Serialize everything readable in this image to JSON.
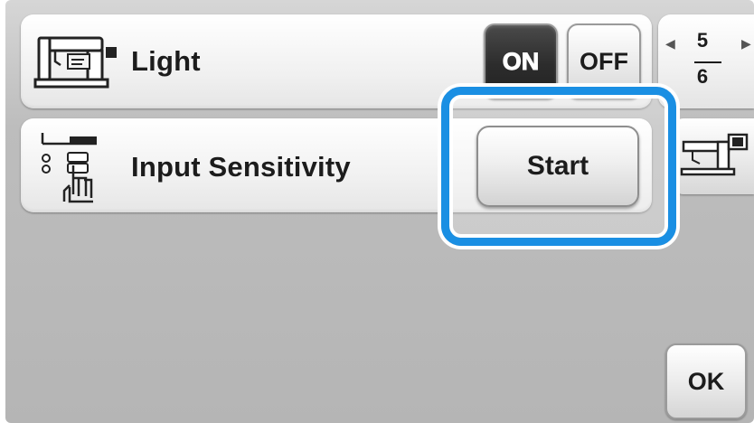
{
  "settings": {
    "light": {
      "label": "Light",
      "icon": "sewing-machine-light-icon",
      "on_label": "ON",
      "off_label": "OFF",
      "selected": "ON"
    },
    "input_sensitivity": {
      "label": "Input Sensitivity",
      "icon": "touch-sensitivity-icon",
      "start_label": "Start"
    }
  },
  "pager": {
    "current": "5",
    "total": "6"
  },
  "side_button": {
    "icon": "sewing-machine-screen-icon"
  },
  "footer": {
    "ok_label": "OK"
  },
  "colors": {
    "highlight": "#1a8fe3",
    "on_button": "#2c2c2c",
    "background": "#bdbdbd"
  }
}
